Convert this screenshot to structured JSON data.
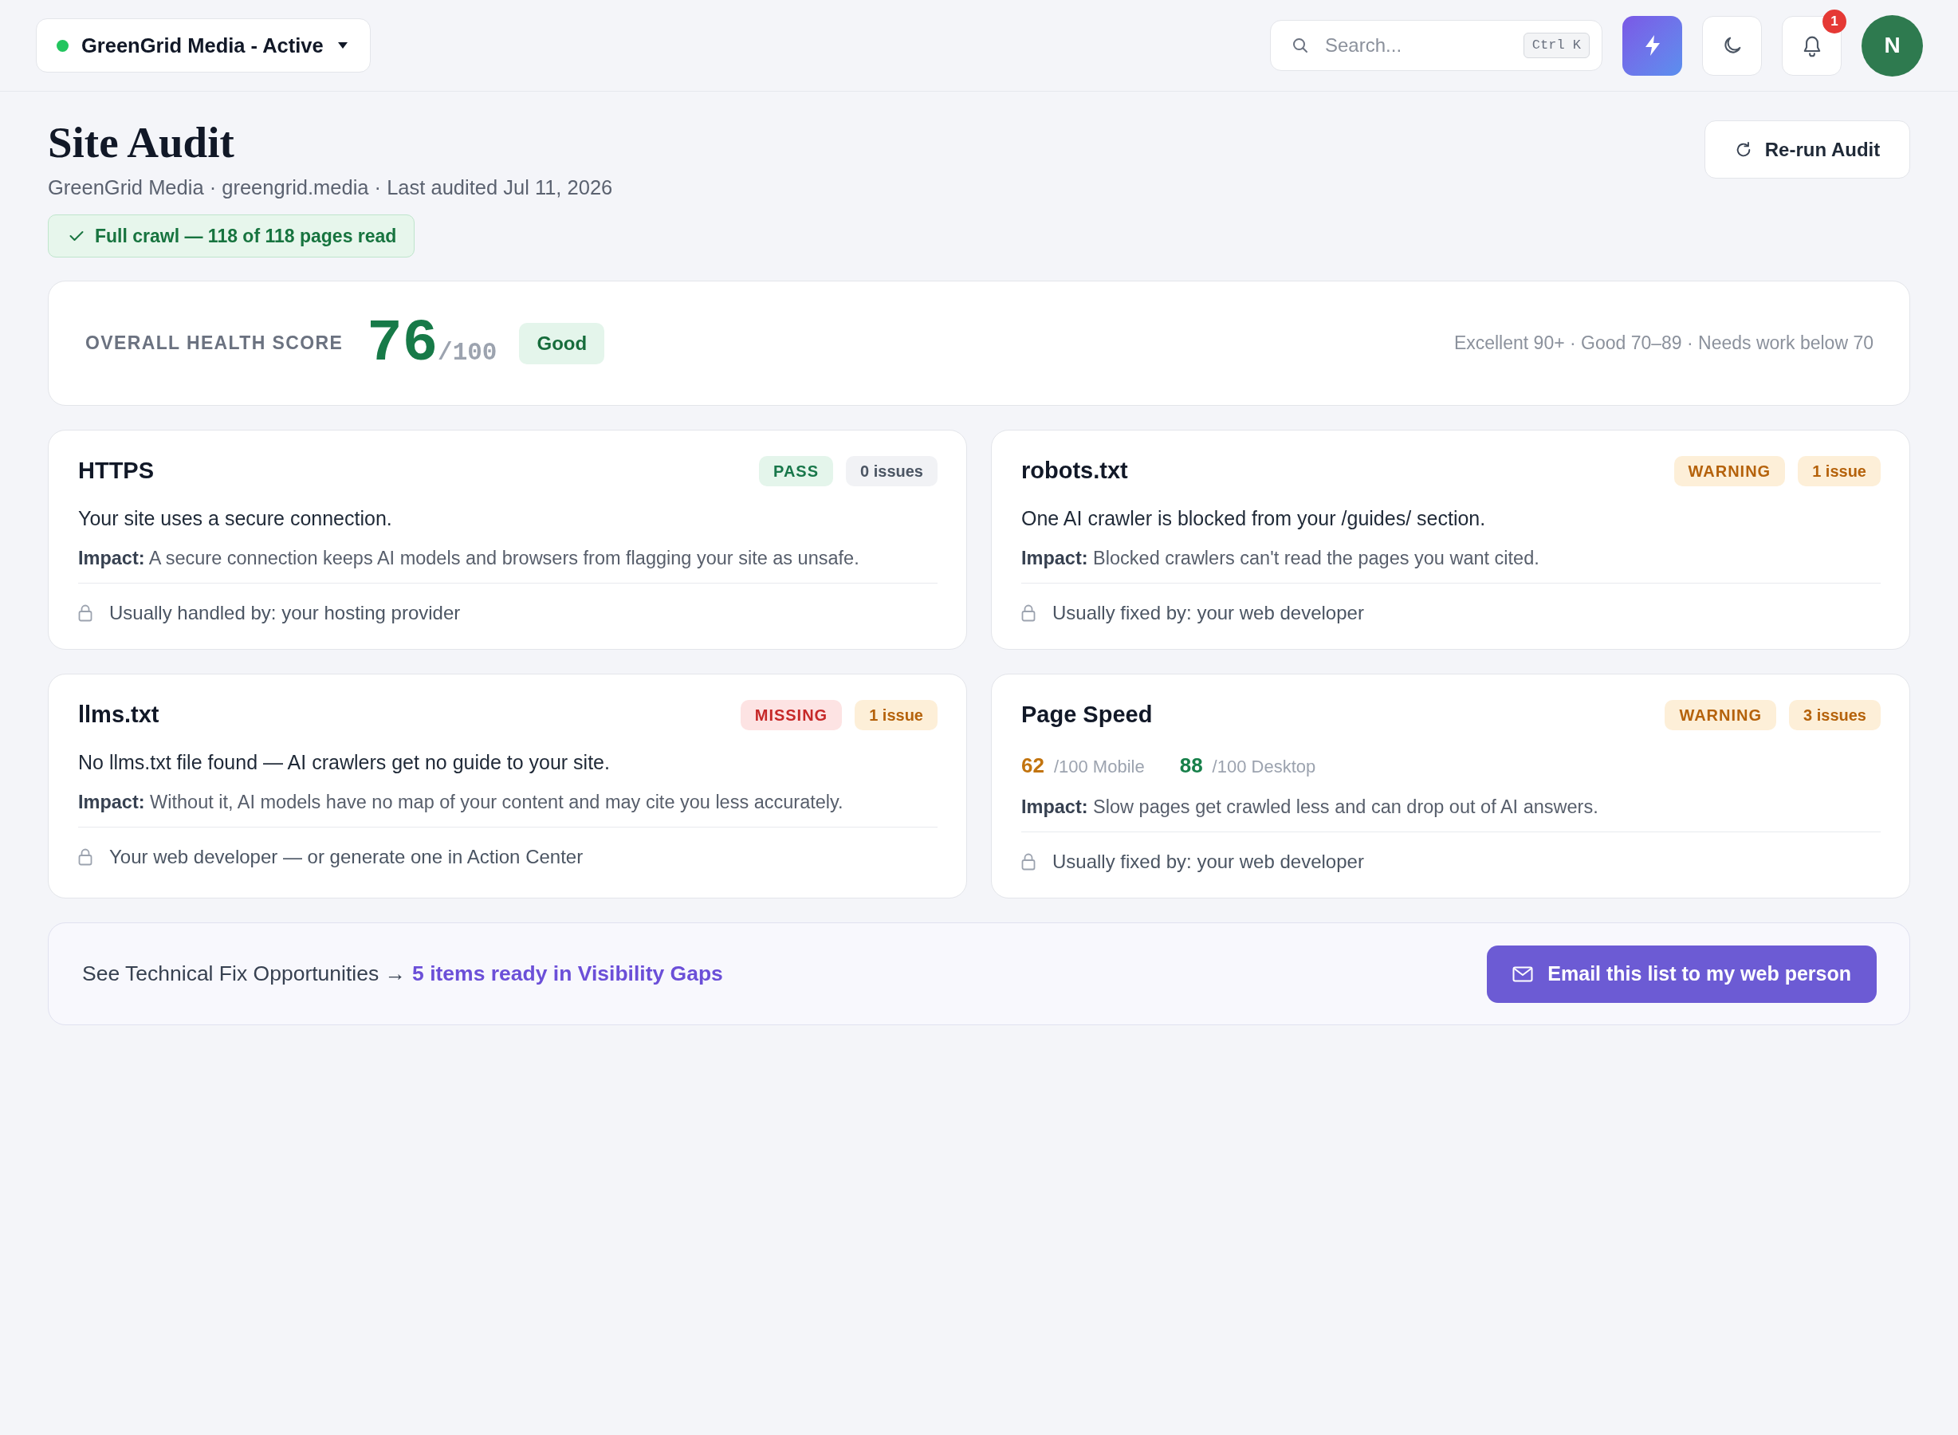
{
  "top_bar": {
    "workspace": {
      "label": "GreenGrid Media - Active"
    },
    "search": {
      "placeholder": "Search...",
      "shortcut": "Ctrl K"
    },
    "notifications": {
      "count": "1"
    },
    "avatar": {
      "initial": "N"
    }
  },
  "header": {
    "title": "Site Audit",
    "subtitle": "GreenGrid Media · greengrid.media · Last audited Jul 11, 2026",
    "crawl_status": "Full crawl — 118 of 118 pages read",
    "rerun_button": "Re-run Audit"
  },
  "health_score": {
    "label": "OVERALL HEALTH SCORE",
    "score": "76",
    "scale": "/100",
    "rating": "Good",
    "legend": "Excellent 90+ · Good 70–89 · Needs work below 70"
  },
  "checks": [
    {
      "title": "HTTPS",
      "status": {
        "label": "PASS",
        "kind": "pass"
      },
      "issues": {
        "label": "0 issues",
        "kind": "neutral"
      },
      "description": "Your site uses a secure connection.",
      "impact": "**Impact:** A secure connection keeps AI models and browsers from flagging your site as unsafe.",
      "owner": "Usually handled by: your hosting provider"
    },
    {
      "title": "robots.txt",
      "status": {
        "label": "WARNING",
        "kind": "warning"
      },
      "issues": {
        "label": "1 issue",
        "kind": "warning"
      },
      "description": "One AI crawler is blocked from your /guides/ section.",
      "impact": "**Impact:** Blocked crawlers can't read the pages you want cited.",
      "owner": "Usually fixed by: your web developer"
    },
    {
      "title": "llms.txt",
      "status": {
        "label": "MISSING",
        "kind": "missing"
      },
      "issues": {
        "label": "1 issue",
        "kind": "warning"
      },
      "description": "No llms.txt file found — AI crawlers get no guide to your site.",
      "impact": "**Impact:** Without it, AI models have no map of your content and may cite you less accurately.",
      "owner": "Your web developer — or generate one in Action Center"
    },
    {
      "title": "Page Speed",
      "status": {
        "label": "WARNING",
        "kind": "warning"
      },
      "issues": {
        "label": "3 issues",
        "kind": "warning"
      },
      "metrics": [
        {
          "value": "62",
          "label": "/100 Mobile",
          "kind": "warning"
        },
        {
          "value": "88",
          "label": "/100 Desktop",
          "kind": "good"
        }
      ],
      "impact": "**Impact:** Slow pages get crawled less and can drop out of AI answers.",
      "owner": "Usually fixed by: your web developer"
    }
  ],
  "fix_opportunities": {
    "text": "See Technical Fix Opportunities →",
    "link": "5 items ready in Visibility Gaps",
    "button": "Email this list to my web person"
  }
}
